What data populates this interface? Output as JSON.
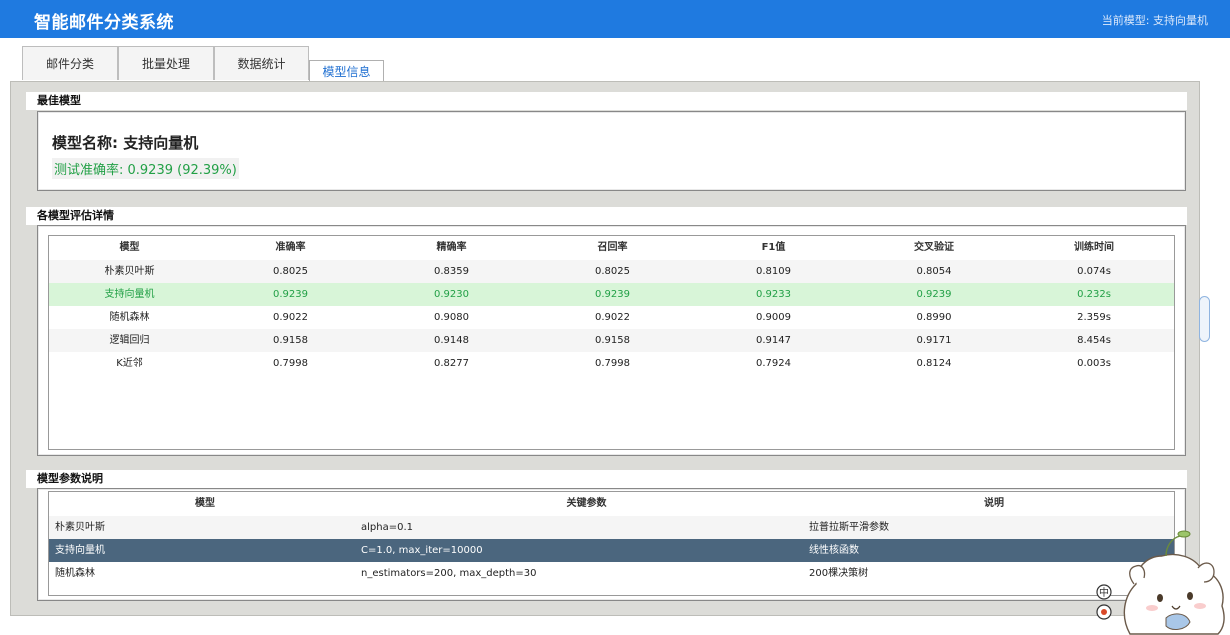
{
  "app": {
    "title": "智能邮件分类系统",
    "current_model": "当前模型: 支持向量机"
  },
  "tabs": [
    {
      "label": "邮件分类",
      "active": false
    },
    {
      "label": "批量处理",
      "active": false
    },
    {
      "label": "数据统计",
      "active": false
    },
    {
      "label": "模型信息",
      "active": true
    }
  ],
  "best_model": {
    "header": "最佳模型",
    "name": "模型名称: 支持向量机",
    "accuracy": "测试准确率: 0.9239 (92.39%)"
  },
  "evaluation": {
    "header": "各模型评估详情",
    "columns": [
      "模型",
      "准确率",
      "精确率",
      "召回率",
      "F1值",
      "交叉验证",
      "训练时间"
    ],
    "rows": [
      {
        "cells": [
          "朴素贝叶斯",
          "0.8025",
          "0.8359",
          "0.8025",
          "0.8109",
          "0.8054",
          "0.074s"
        ],
        "highlight": false
      },
      {
        "cells": [
          "支持向量机",
          "0.9239",
          "0.9230",
          "0.9239",
          "0.9233",
          "0.9239",
          "0.232s"
        ],
        "highlight": true
      },
      {
        "cells": [
          "随机森林",
          "0.9022",
          "0.9080",
          "0.9022",
          "0.9009",
          "0.8990",
          "2.359s"
        ],
        "highlight": false
      },
      {
        "cells": [
          "逻辑回归",
          "0.9158",
          "0.9148",
          "0.9158",
          "0.9147",
          "0.9171",
          "8.454s"
        ],
        "highlight": false
      },
      {
        "cells": [
          "K近邻",
          "0.7998",
          "0.8277",
          "0.7998",
          "0.7924",
          "0.8124",
          "0.003s"
        ],
        "highlight": false
      }
    ]
  },
  "params": {
    "header": "模型参数说明",
    "columns": [
      "模型",
      "关键参数",
      "说明"
    ],
    "rows": [
      {
        "cells": [
          "朴素贝叶斯",
          "alpha=0.1",
          "拉普拉斯平滑参数"
        ],
        "selected": false
      },
      {
        "cells": [
          "支持向量机",
          "C=1.0, max_iter=10000",
          "线性核函数"
        ],
        "selected": true
      },
      {
        "cells": [
          "随机森林",
          "n_estimators=200, max_depth=30",
          "200棵决策树"
        ],
        "selected": false
      }
    ]
  },
  "overlay": {
    "badge_text": "中"
  },
  "colors": {
    "title_bar": "#1f7ae0",
    "accent_green": "#22a046",
    "highlight_row": "#d8f5d8",
    "selected_row": "#4b667e",
    "active_tab_text": "#1f6fd1"
  }
}
